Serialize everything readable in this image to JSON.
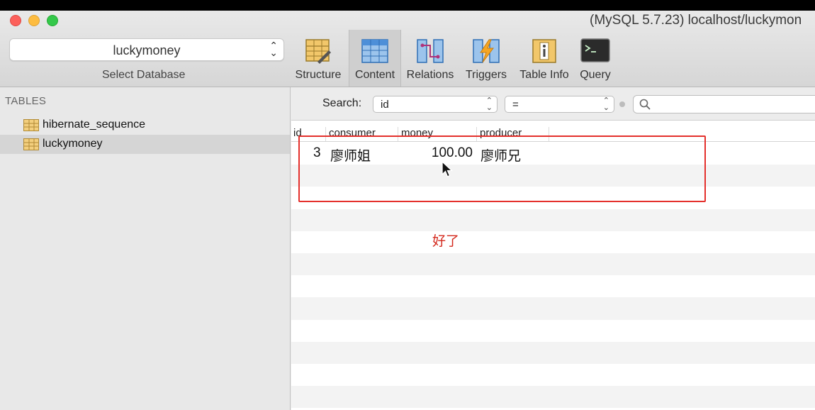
{
  "window": {
    "title": "(MySQL 5.7.23) localhost/luckymon"
  },
  "database": {
    "selected": "luckymoney",
    "label": "Select Database"
  },
  "toolbar": {
    "items": [
      {
        "label": "Structure",
        "icon": "structure-icon"
      },
      {
        "label": "Content",
        "icon": "content-icon",
        "active": true
      },
      {
        "label": "Relations",
        "icon": "relations-icon"
      },
      {
        "label": "Triggers",
        "icon": "triggers-icon"
      },
      {
        "label": "Table Info",
        "icon": "table-info-icon"
      },
      {
        "label": "Query",
        "icon": "terminal-icon"
      }
    ]
  },
  "sidebar": {
    "heading": "TABLES",
    "tables": [
      {
        "name": "hibernate_sequence",
        "selected": false
      },
      {
        "name": "luckymoney",
        "selected": true
      }
    ]
  },
  "filter": {
    "label": "Search:",
    "field": "id",
    "operator": "=",
    "value": ""
  },
  "grid": {
    "columns": [
      "id",
      "consumer",
      "money",
      "producer"
    ],
    "rows": [
      {
        "id": "3",
        "consumer": "廖师姐",
        "money": "100.00",
        "producer": "廖师兄"
      }
    ]
  },
  "annotation": {
    "text": "好了",
    "color": "#d42a1e"
  },
  "colors": {
    "highlight_box": "#e4302c"
  }
}
